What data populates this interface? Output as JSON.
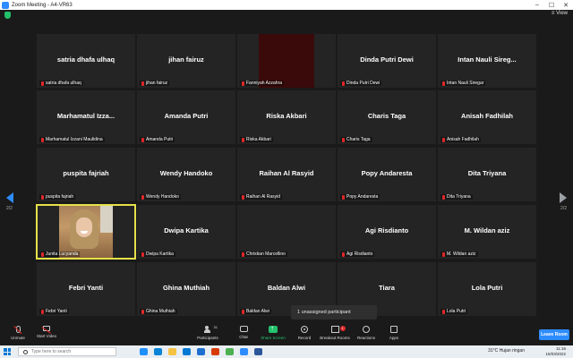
{
  "window": {
    "title": "Zoom Meeting - A4-VR63",
    "controls": [
      "–",
      "☐",
      "✕"
    ],
    "view_label": "≡ View"
  },
  "page_indicator": {
    "left": "2/2",
    "right": "2/2"
  },
  "participants": [
    {
      "name": "satria dhafa ulhaq",
      "label": "satria dhafa ulhaq",
      "video": "none"
    },
    {
      "name": "jihan fairuz",
      "label": "jihan fairuz",
      "video": "none"
    },
    {
      "name": "",
      "label": "Fanniyah Azzahra",
      "video": "dark"
    },
    {
      "name": "Dinda Putri Dewi",
      "label": "Dinda Putri Dewi",
      "video": "none"
    },
    {
      "name": "Intan Nauli Sireg...",
      "label": "Intan Nauli Siregar",
      "video": "none"
    },
    {
      "name": "Marhamatul Izza...",
      "label": "Marhamatul Izzani Maulidina",
      "video": "none"
    },
    {
      "name": "Amanda Putri",
      "label": "Amanda Putri",
      "video": "none"
    },
    {
      "name": "Riska Akbari",
      "label": "Riska Akbari",
      "video": "none"
    },
    {
      "name": "Charis Taga",
      "label": "Charis Taga",
      "video": "none"
    },
    {
      "name": "Anisah Fadhilah",
      "label": "Anisah Fadhilah",
      "video": "none"
    },
    {
      "name": "puspita fajriah",
      "label": "puspita fajriah",
      "video": "none"
    },
    {
      "name": "Wendy Handoko",
      "label": "Wendy Handoko",
      "video": "none"
    },
    {
      "name": "Raihan Al Rasyid",
      "label": "Raihan Al Rasyid",
      "video": "none"
    },
    {
      "name": "Popy Andaresta",
      "label": "Popy Andaresta",
      "video": "none"
    },
    {
      "name": "Dita Triyana",
      "label": "Dita Triyana",
      "video": "none"
    },
    {
      "name": "",
      "label": "Junita Lucyanda",
      "video": "person",
      "active": true
    },
    {
      "name": "Dwipa Kartika",
      "label": "Dwipa Kartika",
      "video": "none"
    },
    {
      "name": "",
      "label": "Christian Marcellino",
      "video": "none"
    },
    {
      "name": "Agi Risdianto",
      "label": "Agi Risdianto",
      "video": "none"
    },
    {
      "name": "M. Wildan aziz",
      "label": "M. Wildan aziz",
      "video": "none"
    },
    {
      "name": "Febri Yanti",
      "label": "Febri Yanti",
      "video": "none"
    },
    {
      "name": "Ghina Muthiah",
      "label": "Ghina Muthiah",
      "video": "none"
    },
    {
      "name": "Baldan Alwi",
      "label": "Baldan Alwi",
      "video": "none"
    },
    {
      "name": "Tiara",
      "label": "",
      "video": "none"
    },
    {
      "name": "Lola Putri",
      "label": "Lola Putri",
      "video": "none"
    }
  ],
  "tooltip": {
    "text": "1 unassigned participant"
  },
  "toolbar": {
    "unmute": "Unmute",
    "start_video": "Start Video",
    "participants": "Participants",
    "participants_count": "31",
    "chat": "Chat",
    "share_screen": "Share Screen",
    "record": "Record",
    "breakout": "Breakout Rooms",
    "breakout_badge": "1",
    "reactions": "Reactions",
    "apps": "Apps",
    "leave": "Leave Room"
  },
  "taskbar": {
    "search_placeholder": "Type here to search",
    "weather": "31°C  Hujan ringan",
    "time": "11:16",
    "date": "16/03/2022"
  },
  "colors": {
    "accent": "#2d8cff",
    "share_green": "#23c06b",
    "muted_red": "#e02828",
    "active_speaker": "#e6e14a"
  }
}
